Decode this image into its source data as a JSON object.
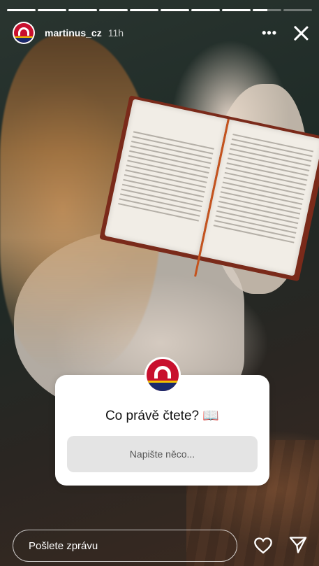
{
  "story": {
    "username": "martinus_cz",
    "time": "11h",
    "more_icon": "•••",
    "segments": [
      1,
      1,
      1,
      1,
      1,
      1,
      1,
      1,
      0.5,
      0
    ]
  },
  "sticker": {
    "question": "Co právě čtete? 📖",
    "placeholder": "Napište něco..."
  },
  "footer": {
    "reply_placeholder": "Pošlete zprávu"
  },
  "colors": {
    "brand_red": "#c8102e",
    "brand_blue": "#1a2a6c",
    "brand_yellow": "#f2c200"
  }
}
